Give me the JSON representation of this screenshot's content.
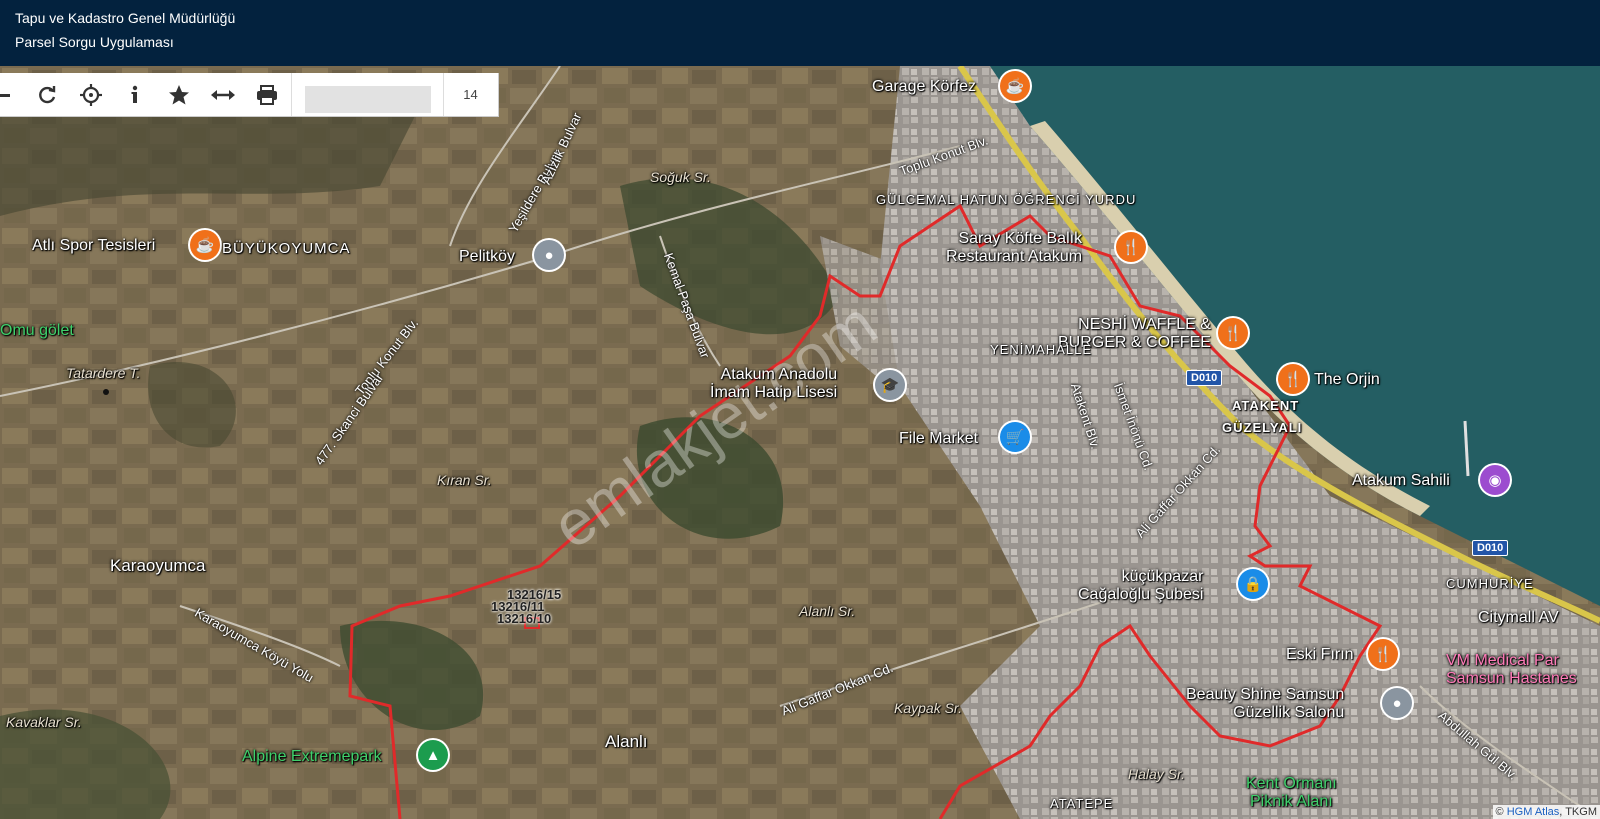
{
  "header": {
    "title": "Tapu ve Kadastro Genel Müdürlüğü",
    "subtitle": "Parsel Sorgu Uygulaması"
  },
  "toolbar": {
    "zoom_level": "14",
    "buttons": [
      "minus-icon",
      "refresh-icon",
      "locate-icon",
      "info-icon",
      "star-icon",
      "measure-icon",
      "print-icon"
    ]
  },
  "map": {
    "places": {
      "garage_korfez": "Garage Körfez",
      "gulcemal": "GÜLCEMAL HATUN ÖĞRENCİ YURDU",
      "saray_kofte": "Saray Köfte Balık\nRestaurant Atakum",
      "neshi_waffle": "NESHİ WAFFLE &\nBURGER & COFFEE",
      "orjin": "The Orjin",
      "atakent": "ATAKENT",
      "guzelyali": "GÜZELYALI",
      "atakum_sahili": "Atakum Sahili",
      "atli_spor": "Atlı Spor Tesisleri",
      "buyukoyumca": "BÜYÜKOYUMCA",
      "pelitkoy": "Pelitköy",
      "omu_golet": "Omu gölet",
      "tatardere": "Tatardere T.",
      "atakum_anadolu": "Atakum Anadolu\nİmam Hatip Lisesi",
      "file_market": "File Market",
      "kiran_sr": "Kıran Sr.",
      "karaoyumca": "Karaoyumca",
      "kucukpazar": "küçükpazar\nCağaloğlu Şubesi",
      "eski_firin": "Eski Fırın",
      "beauty_shine": "Beauty Shine Samsun\nGüzellik Salonu",
      "citymall": "Citymall AV",
      "vm_medical": "VM Medical Par\nSamsun Hastanes",
      "cumhuriyet": "CUMHURİYE",
      "alpine": "Alpine Extremepark",
      "alanli": "Alanlı",
      "alanli_sr": "Alanlı Sr.",
      "kavaklar_sr": "Kavaklar Sr.",
      "kaypak_sr": "Kaypak Sr.",
      "halay_sr": "Halay Sr.",
      "kent_ormani": "Kent Ormanı\nPiknik Alanı",
      "yenimahalle": "YENİMAHALLE",
      "atatepe": "ATATEPE",
      "soguk_sr": "Soğuk Sr."
    },
    "roads": {
      "toplu_konut_blv_top": "Toplu Konut Blv.",
      "toplu_konut_blv_left": "Toplu Konut Blv.",
      "yesildere": "Yeşildere Bulvar",
      "azizlik": "Azizlik Bulvar",
      "kemal_pasa": "Kemal Paşa Bulvar",
      "skanci": "477. Skanci Bulvar",
      "atakent_blv": "Atakent Blv.",
      "ismet_inonu": "İsmet İnönü Cd.",
      "ali_gaffar_1": "Ali Gaffar Okkan Cd.",
      "ali_gaffar_2": "Ali Gaffar Okkan Cd.",
      "karaoyumca_koyu": "Karaoyumca Köyü Yolu",
      "abdullah_gul": "Abdullah Gül Blv."
    },
    "shields": [
      "D010",
      "D010"
    ],
    "parcels": [
      "13216/15",
      "13216/11",
      "13216/10"
    ],
    "watermark": "emlakjet.com",
    "attribution_prefix": "©",
    "attribution_link": "HGM Atlas",
    "attribution_suffix": ", TKGM"
  }
}
